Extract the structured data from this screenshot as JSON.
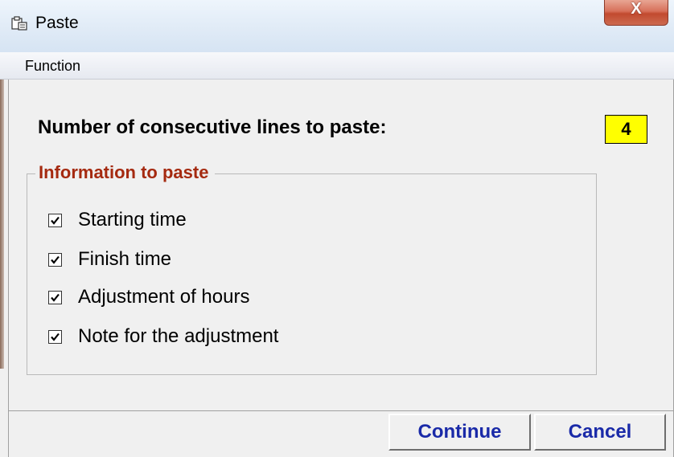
{
  "window": {
    "title": "Paste",
    "close_label": "X"
  },
  "menu": {
    "items": [
      {
        "label": "Function"
      }
    ]
  },
  "dialog": {
    "question_label": "Number of consecutive lines to paste:",
    "line_count": "4",
    "group_title": "Information to paste",
    "options": [
      {
        "label": "Starting time",
        "checked": true
      },
      {
        "label": "Finish time",
        "checked": true
      },
      {
        "label": "Adjustment of hours",
        "checked": true
      },
      {
        "label": "Note for the adjustment",
        "checked": true
      }
    ]
  },
  "buttons": {
    "continue_label": "Continue",
    "cancel_label": "Cancel"
  },
  "colors": {
    "count_box_bg": "#ffff00",
    "group_title": "#a52a10",
    "button_text": "#1a2aa8"
  }
}
